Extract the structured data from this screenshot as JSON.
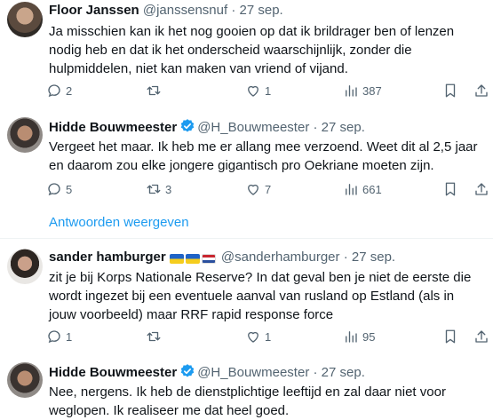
{
  "tweets": [
    {
      "name": "Floor Janssen",
      "handle": "@janssensnuf",
      "date": "27 sep.",
      "text": "Ja misschien kan ik het nog gooien op dat ik brildrager ben of lenzen nodig heb en dat ik het onderscheid waarschijnlijk, zonder die hulpmiddelen, niet kan maken van vriend of vijand.",
      "replies": "2",
      "retweets": "",
      "likes": "1",
      "views": "387"
    },
    {
      "name": "Hidde Bouwmeester",
      "handle": "@H_Bouwmeester",
      "date": "27 sep.",
      "text": "Vergeet het maar. Ik heb me er allang mee verzoend. Weet dit al 2,5 jaar en daarom zou elke jongere gigantisch pro Oekriane moeten zijn.",
      "replies": "5",
      "retweets": "3",
      "likes": "7",
      "views": "661"
    },
    {
      "name": "sander hamburger",
      "handle": "@sanderhamburger",
      "date": "27 sep.",
      "text": "zit je bij Korps Nationale Reserve? In dat geval ben je niet de eerste die wordt ingezet bij een eventuele aanval van rusland op Estland (als in jouw voorbeeld) maar RRF rapid response force",
      "replies": "1",
      "retweets": "",
      "likes": "1",
      "views": "95"
    },
    {
      "name": "Hidde Bouwmeester",
      "handle": "@H_Bouwmeester",
      "date": "27 sep.",
      "text": "Nee, nergens. Ik heb de dienstplichtige leeftijd en zal daar niet voor weglopen. Ik realiseer me dat heel goed."
    }
  ],
  "show_replies_label": "Antwoorden weergeven",
  "separator": " · ",
  "colors": {
    "link": "#1d9bf0",
    "muted": "#536471",
    "verified": "#1d9bf0"
  }
}
